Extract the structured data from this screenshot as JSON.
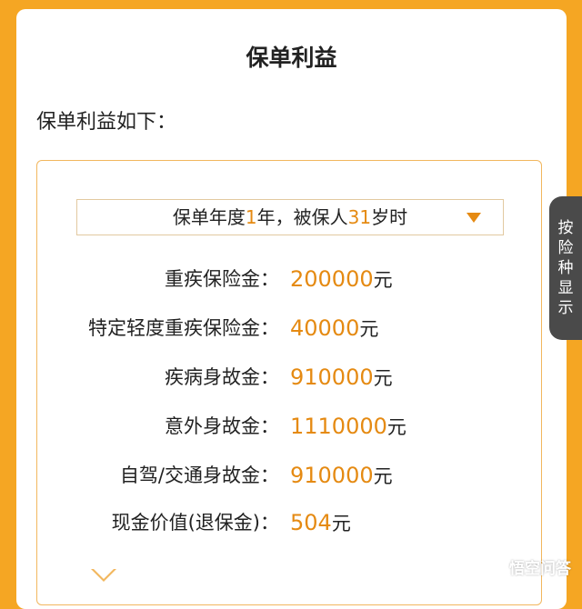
{
  "page": {
    "title": "保单利益",
    "intro": "保单利益如下："
  },
  "selector": {
    "prefix": "保单年度",
    "year": "1",
    "middle": "年，被保人",
    "age": "31",
    "suffix": "岁时",
    "arrow_icon": "caret-down-icon"
  },
  "benefits": [
    {
      "label": "重疾保险金：",
      "value": "200000",
      "unit": "元"
    },
    {
      "label": "特定轻度重疾保险金：",
      "value": "40000",
      "unit": "元"
    },
    {
      "label": "疾病身故金：",
      "value": "910000",
      "unit": "元"
    },
    {
      "label": "意外身故金：",
      "value": "1110000",
      "unit": "元"
    },
    {
      "label": "自驾/交通身故金：",
      "value": "910000",
      "unit": "元"
    },
    {
      "label": "现金价值(退保金)：",
      "value": "504",
      "unit": "元"
    }
  ],
  "side_tab": {
    "chars": [
      "按",
      "险",
      "种",
      "显",
      "示"
    ]
  },
  "watermark": {
    "text": "悟空问答",
    "icon": "chat-bubble-icon"
  },
  "colors": {
    "background": "#F5A623",
    "accent": "#E58A12",
    "box_border": "#F2B75E",
    "tab_bg": "#4A4A4A"
  }
}
